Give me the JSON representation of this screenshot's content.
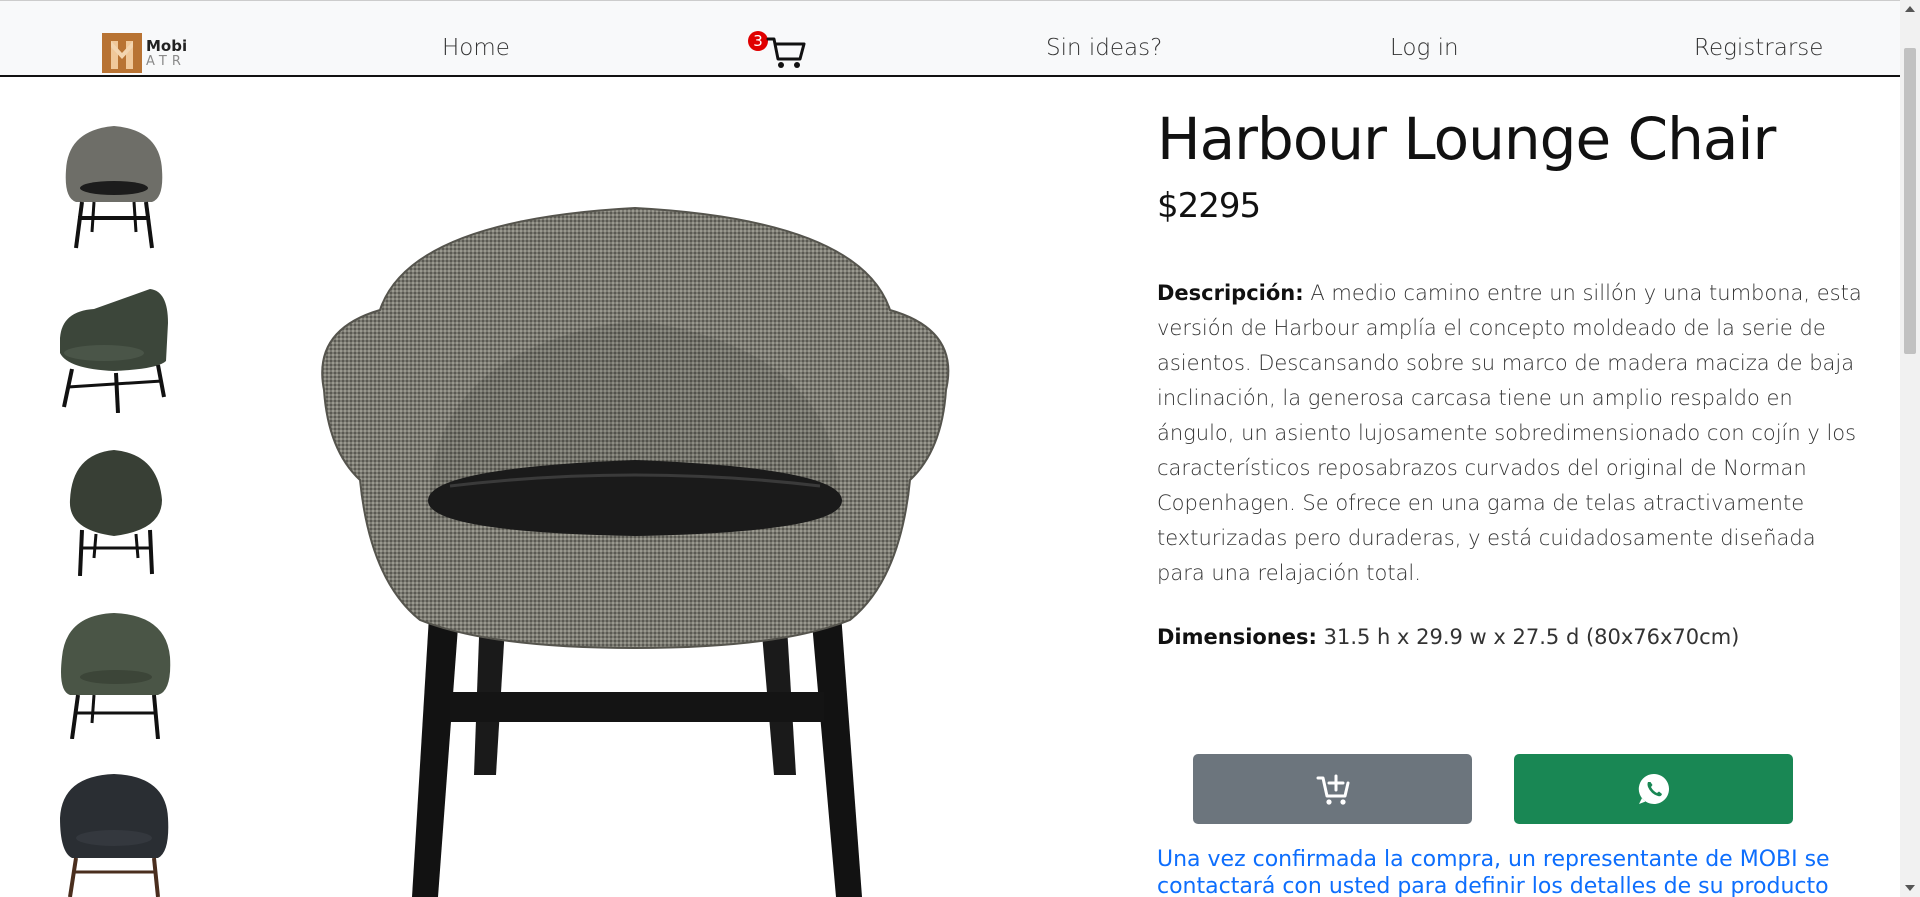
{
  "brand": {
    "name_line1": "Mobi",
    "name_line2": "ATR",
    "logo_color": "#b87333"
  },
  "nav": {
    "home": "Home",
    "cart_count": "3",
    "ideas": "Sin ideas?",
    "login": "Log in",
    "register": "Registrarse"
  },
  "thumbnails": [
    {
      "alt": "Harbour chair grey fabric front"
    },
    {
      "alt": "Harbour chair green angle"
    },
    {
      "alt": "Harbour chair green back"
    },
    {
      "alt": "Harbour chair green front"
    },
    {
      "alt": "Harbour chair black leather"
    }
  ],
  "product": {
    "title": "Harbour Lounge Chair",
    "price": "$2295",
    "description_label": "Descripción:",
    "description": " A medio camino entre un sillón y una tumbona, esta versión de Harbour amplía el concepto moldeado de la serie de asientos. Descansando sobre su marco de madera maciza de baja inclinación, la generosa carcasa tiene un amplio respaldo en ángulo, un asiento lujosamente sobredimensionado con cojín y los característicos reposabrazos curvados del original de Norman Copenhagen. Se ofrece en una gama de telas atractivamente texturizadas pero duraderas, y está cuidadosamente diseñada para una relajación total.",
    "dimensions_label": "Dimensiones:",
    "dimensions": " 31.5 h x 29.9 w x 27.5 d (80x76x70cm)",
    "notice": "Una vez confirmada la compra, un representante de MOBI se contactará con usted para definir los detalles de su producto"
  },
  "buttons": {
    "add_to_cart_icon": "cart-plus-icon",
    "whatsapp_icon": "whatsapp-icon",
    "cart_color": "#6c757d",
    "whatsapp_color": "#198754"
  }
}
